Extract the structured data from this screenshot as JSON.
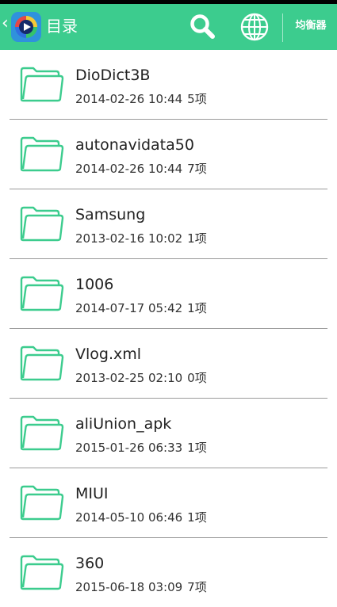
{
  "header": {
    "title": "目录",
    "back_icon": "chevron-left-icon",
    "app_logo_icon": "video-player-app-icon",
    "search_icon": "search-icon",
    "globe_icon": "globe-icon",
    "equalizer_label": "均衡器",
    "accent_color": "#3ccc8e"
  },
  "files": [
    {
      "name": "DioDict3B",
      "date": "2014-02-26 10:44",
      "count": "5项",
      "icon": "folder-icon"
    },
    {
      "name": "autonavidata50",
      "date": "2014-02-26 10:44",
      "count": "7项",
      "icon": "folder-icon"
    },
    {
      "name": "Samsung",
      "date": "2013-02-16 10:02",
      "count": "1项",
      "icon": "folder-icon"
    },
    {
      "name": "1006",
      "date": "2014-07-17 05:42",
      "count": "1项",
      "icon": "folder-icon"
    },
    {
      "name": "Vlog.xml",
      "date": "2013-02-25 02:10",
      "count": "0项",
      "icon": "folder-icon"
    },
    {
      "name": "aliUnion_apk",
      "date": "2015-01-26 06:33",
      "count": "1项",
      "icon": "folder-icon"
    },
    {
      "name": "MIUI",
      "date": "2014-05-10 06:46",
      "count": "1项",
      "icon": "folder-icon"
    },
    {
      "name": "360",
      "date": "2015-06-18 03:09",
      "count": "7项",
      "icon": "folder-icon"
    }
  ]
}
